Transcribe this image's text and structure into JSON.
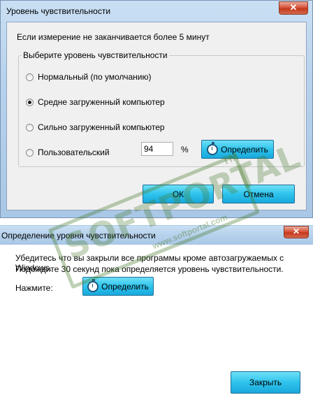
{
  "dialog": {
    "title": "Уровень чувствительности",
    "close_label": "✕",
    "intro": "Если измерение не заканчивается более 5 минут",
    "group_label": "Выберите уровень чувствительности",
    "options": [
      {
        "label": "Нормальный (по умолчанию)",
        "checked": false
      },
      {
        "label": "Средне загруженный компьютер",
        "checked": true
      },
      {
        "label": "Сильно загруженный компьютер",
        "checked": false
      },
      {
        "label": "Пользовательский",
        "checked": false
      }
    ],
    "custom_value": "94",
    "percent_sign": "%",
    "determine_label": "Определить",
    "ok_label": "ОК",
    "cancel_label": "Отмена"
  },
  "dialog2": {
    "title": "Определение уровня чувствительности",
    "close_label": "✕",
    "line1": "Убедитесь что вы закрыли все программы кроме автозагружаемых с Windows.",
    "line2": "Подождите 30 секунд пока определяется уровень чувствительности.",
    "press_label": "Нажмите:",
    "determine_label": "Определить",
    "close_button_label": "Закрыть"
  },
  "watermark": {
    "brand": "SOFTPORTAL",
    "tm": "TM",
    "url": "www.softportal.com"
  },
  "colors": {
    "button_accent": "#2ec3ec",
    "title_bar": "#b6d1ec",
    "close_red": "#c4381c"
  }
}
